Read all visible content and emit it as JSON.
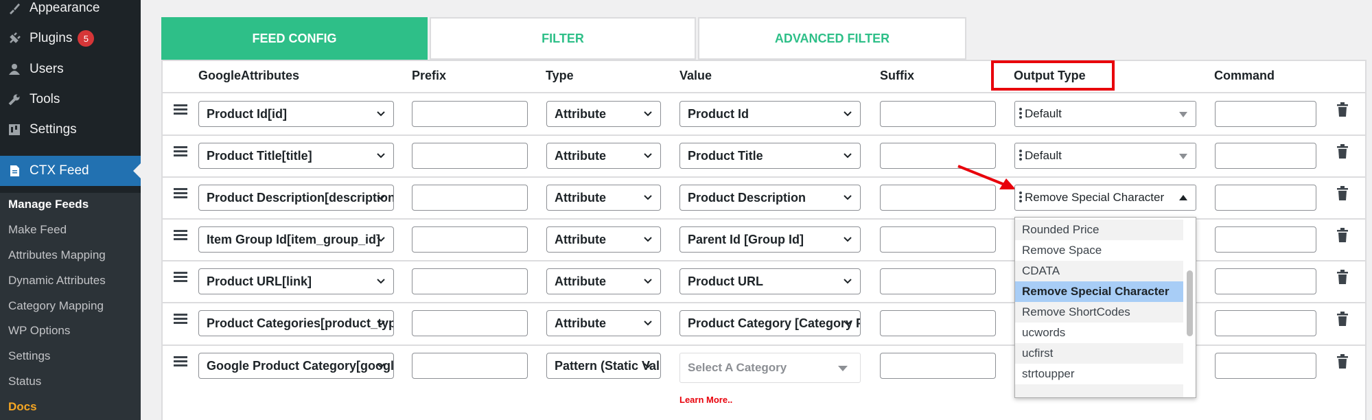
{
  "sidebar": {
    "menu": [
      {
        "label": "Appearance",
        "icon": "paintbrush-icon"
      },
      {
        "label": "Plugins",
        "icon": "plugin-icon",
        "badge": "5"
      },
      {
        "label": "Users",
        "icon": "user-icon"
      },
      {
        "label": "Tools",
        "icon": "wrench-icon"
      },
      {
        "label": "Settings",
        "icon": "settings-icon"
      },
      {
        "label": "CTX Feed",
        "icon": "document-icon"
      }
    ],
    "submenu": [
      "Manage Feeds",
      "Make Feed",
      "Attributes Mapping",
      "Dynamic Attributes",
      "Category Mapping",
      "WP Options",
      "Settings",
      "Status",
      "Docs"
    ]
  },
  "tabs": [
    "FEED CONFIG",
    "FILTER",
    "ADVANCED FILTER"
  ],
  "columns": [
    "GoogleAttributes",
    "Prefix",
    "Type",
    "Value",
    "Suffix",
    "Output Type",
    "Command"
  ],
  "rows": [
    {
      "attribute": "Product Id[id]",
      "type": "Attribute",
      "value": "Product Id",
      "output": "Default"
    },
    {
      "attribute": "Product Title[title]",
      "type": "Attribute",
      "value": "Product Title",
      "output": "Default"
    },
    {
      "attribute": "Product Description[description]",
      "type": "Attribute",
      "value": "Product Description",
      "output": "Remove Special Character"
    },
    {
      "attribute": "Item Group Id[item_group_id]",
      "type": "Attribute",
      "value": "Parent Id [Group Id]",
      "output": ""
    },
    {
      "attribute": "Product URL[link]",
      "type": "Attribute",
      "value": "Product URL",
      "output": ""
    },
    {
      "attribute": "Product Categories[product_type]",
      "type": "Attribute",
      "value": "Product Category [Category Path]",
      "output": ""
    },
    {
      "attribute": "Google Product Category[google_product_category]",
      "type": "Pattern (Static Value)",
      "value": "",
      "output": ""
    }
  ],
  "value_placeholder": "Select A Category",
  "learn_more": "Learn More..",
  "dropdown_options": [
    "Rounded Price",
    "Remove Space",
    "CDATA",
    "Remove Special Character",
    "Remove ShortCodes",
    "ucwords",
    "ucfirst",
    "strtoupper"
  ],
  "dropdown_selected": "Remove Special Character",
  "colors": {
    "accent": "#2ebf88",
    "highlight": "#e8000b",
    "wp_blue": "#2271b1",
    "sidebar": "#1d2327"
  }
}
